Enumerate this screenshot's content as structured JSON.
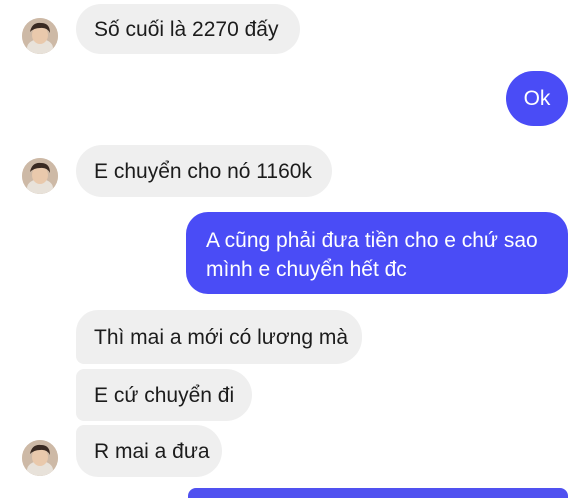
{
  "colors": {
    "incoming_bubble": "#efefef",
    "outgoing_bubble": "#4a4cf6",
    "incoming_text": "#1c1c1c",
    "outgoing_text": "#ffffff"
  },
  "messages": [
    {
      "direction": "incoming",
      "text": "Số cuối là 2270 đấy",
      "avatar": "avatar-photo"
    },
    {
      "direction": "outgoing",
      "text": "Ok"
    },
    {
      "direction": "incoming",
      "text": "E chuyển cho nó 1160k",
      "avatar": "avatar-photo"
    },
    {
      "direction": "outgoing",
      "text": "A cũng phải đưa tiền cho e chứ sao mình e chuyển hết đc"
    },
    {
      "direction": "incoming",
      "text": "Thì mai a mới có lương mà"
    },
    {
      "direction": "incoming",
      "text": "E cứ chuyển đi"
    },
    {
      "direction": "incoming",
      "text": "R mai a đưa",
      "avatar": "avatar-photo"
    }
  ]
}
